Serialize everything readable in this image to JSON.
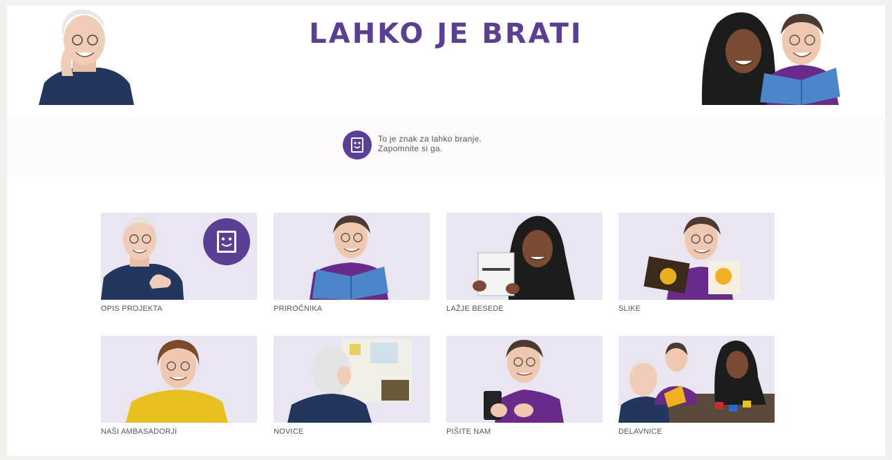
{
  "header": {
    "title": "LAHKO JE BRATI"
  },
  "notice": {
    "line1": "To je znak za lahko branje.",
    "line2": "Zapomnite si ga."
  },
  "tiles": [
    {
      "label": "OPIS PROJEKTA"
    },
    {
      "label": "PRIROČNIKA"
    },
    {
      "label": "LAŽJE BESEDE"
    },
    {
      "label": "SLIKE"
    },
    {
      "label": "NAŠI AMBASADORJI"
    },
    {
      "label": "NOVICE"
    },
    {
      "label": "PIŠITE NAM"
    },
    {
      "label": "DELAVNICE"
    }
  ],
  "colors": {
    "brand": "#5b3f94",
    "tile_bg": "#e9e6f1",
    "label": "#555555"
  }
}
